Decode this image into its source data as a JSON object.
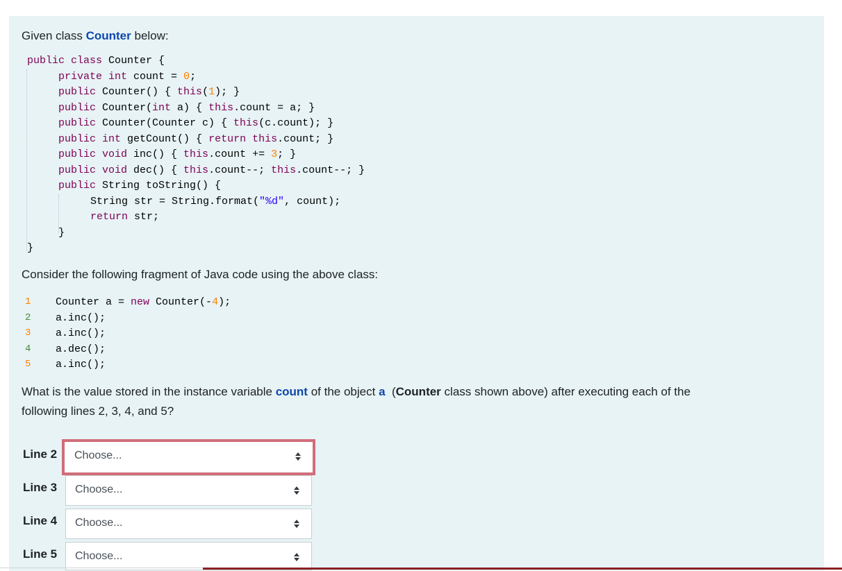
{
  "intro": {
    "prefix": "Given class ",
    "class_name": "Counter",
    "suffix": " below:"
  },
  "class_code": [
    "public class Counter {",
    "private int count = 0;",
    "public Counter() { this(1); }",
    "public Counter(int a) { this.count = a; }",
    "public Counter(Counter c) { this(c.count); }",
    "public int getCount() { return this.count; }",
    "public void inc() { this.count += 3; }",
    "public void dec() { this.count--; this.count--; }",
    "public String toString() {",
    "String str = String.format(\"%d\", count);",
    "return str;",
    "}",
    "}"
  ],
  "fragment_intro": "Consider the following fragment of Java code using the above class:",
  "fragment": {
    "line_numbers": [
      "1",
      "2",
      "3",
      "4",
      "5"
    ],
    "lines": [
      "Counter a = new Counter(-4);",
      "a.inc();",
      "a.inc();",
      "a.dec();",
      "a.inc();"
    ]
  },
  "question": {
    "p1": "What is the value stored in the instance variable ",
    "var": "count",
    "p2": " of the object ",
    "obj": "a",
    "p3": "  (",
    "cls": "Counter",
    "p4": " class shown above) after executing each of the",
    "line2": "following lines 2, 3, 4, and 5?"
  },
  "answers": [
    {
      "label": "Line 2",
      "value": "Choose..."
    },
    {
      "label": "Line 3",
      "value": "Choose..."
    },
    {
      "label": "Line 4",
      "value": "Choose..."
    },
    {
      "label": "Line 5",
      "value": "Choose..."
    }
  ],
  "colors": {
    "panel": "#e7f3f5",
    "highlight_text": "#0f47ad",
    "focus_border": "#d16d7a",
    "keyword": "#7f0055",
    "number": "#ff8000"
  }
}
